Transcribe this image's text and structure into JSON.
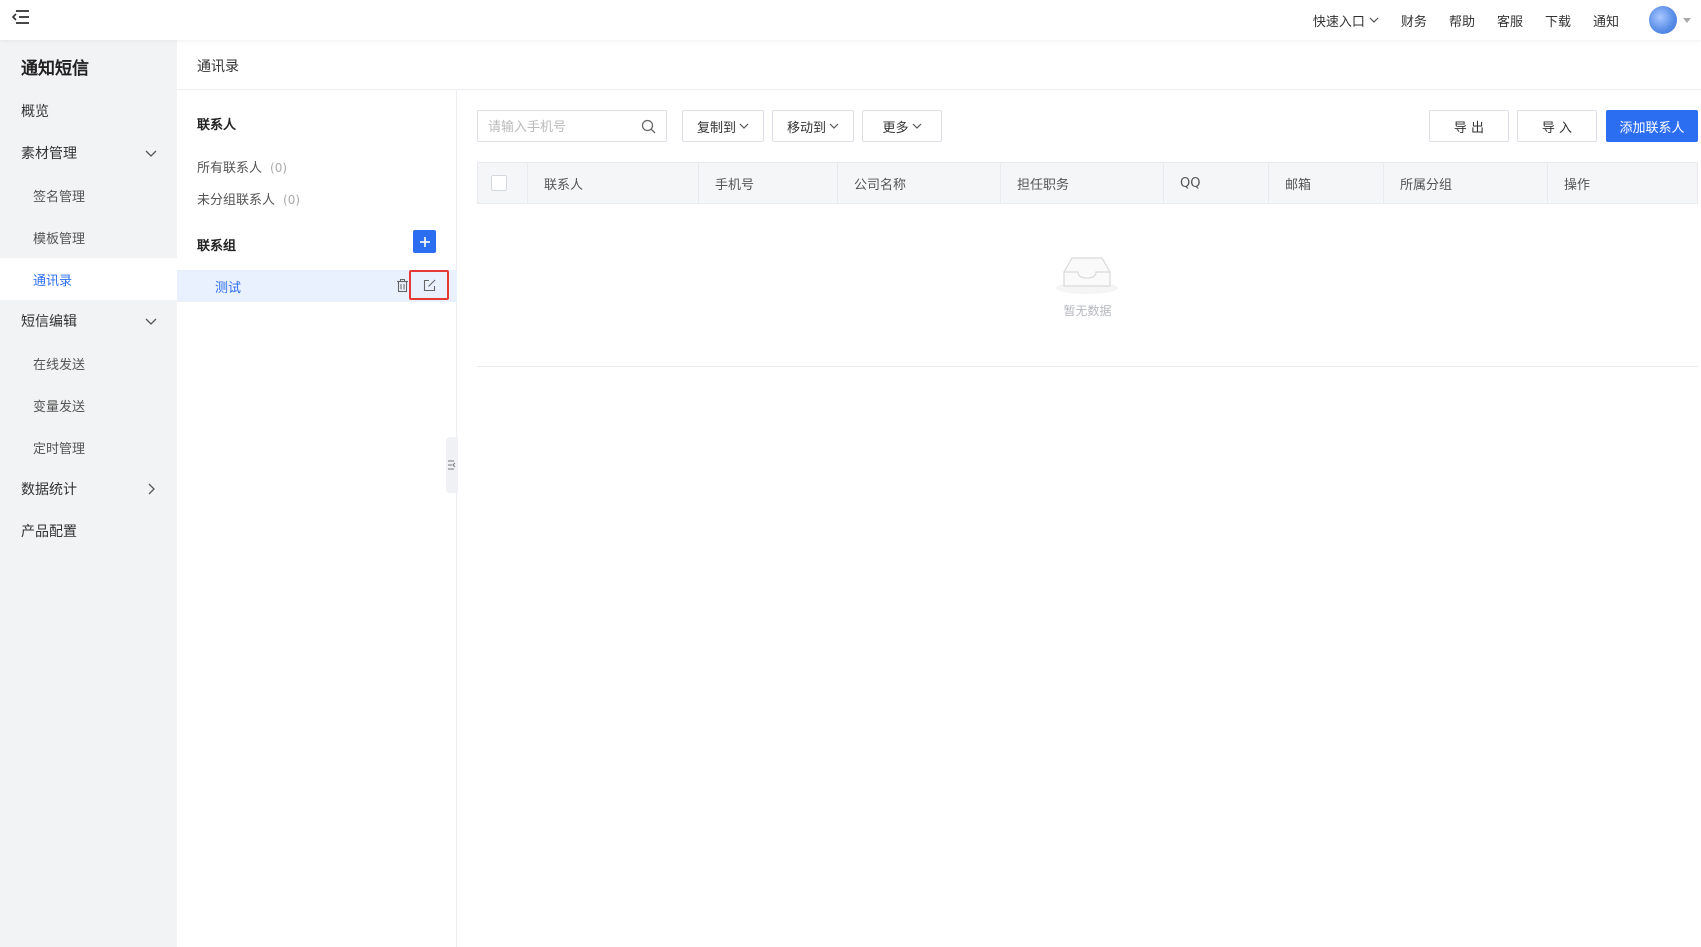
{
  "topbar": {
    "quick_entry": "快速入口",
    "links": [
      "财务",
      "帮助",
      "客服",
      "下载",
      "通知"
    ]
  },
  "sidebar": {
    "title": "通知短信",
    "items": {
      "overview": "概览",
      "material": "素材管理",
      "signature": "签名管理",
      "template": "模板管理",
      "contacts": "通讯录",
      "sms_edit": "短信编辑",
      "online_send": "在线发送",
      "variable_send": "变量发送",
      "timer": "定时管理",
      "stats": "数据统计",
      "product_config": "产品配置"
    }
  },
  "page": {
    "title": "通讯录"
  },
  "contacts_panel": {
    "contacts_header": "联系人",
    "all_contacts": "所有联系人",
    "all_count": "(0)",
    "ungrouped": "未分组联系人",
    "ungrouped_count": "(0)",
    "groups_header": "联系组",
    "groups": [
      "测试"
    ]
  },
  "toolbar": {
    "search_placeholder": "请输入手机号",
    "copy_to": "复制到",
    "move_to": "移动到",
    "more": "更多",
    "export": "导 出",
    "import": "导 入",
    "add_contact": "添加联系人"
  },
  "table": {
    "columns": [
      "联系人",
      "手机号",
      "公司名称",
      "担任职务",
      "QQ",
      "邮箱",
      "所属分组",
      "操作"
    ],
    "empty_text": "暂无数据"
  },
  "colors": {
    "primary": "#2c6ef2",
    "highlight_border": "#e53935",
    "sidebar_bg": "#f2f3f5"
  }
}
